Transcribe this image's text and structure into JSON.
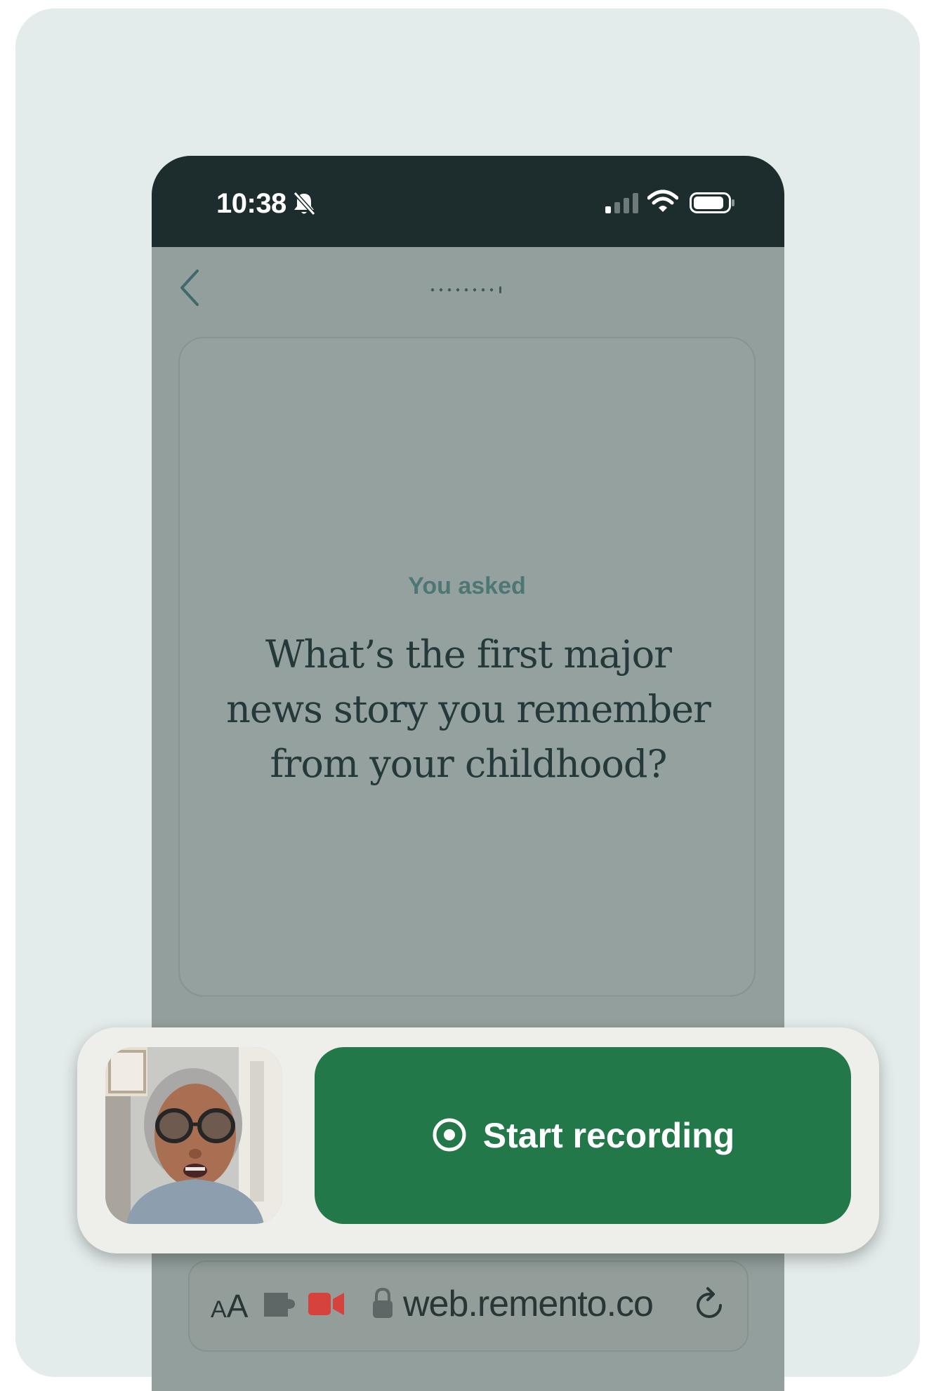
{
  "status_bar": {
    "time": "10:38"
  },
  "prompt": {
    "eyebrow": "You asked",
    "question": "What’s the first major news story you remember from your childhood?"
  },
  "recording": {
    "start_label": "Start recording"
  },
  "browser": {
    "text_size_label_small": "A",
    "text_size_label_large": "A",
    "url": "web.remento.co"
  },
  "colors": {
    "status_bar_bg": "#1d2c2c",
    "overlay_bg": "#939f9c",
    "accent_green": "#23784a",
    "eyebrow_teal": "#4c7775",
    "panel_bg": "#eeefea",
    "recording_indicator": "#d6433c"
  },
  "icons": [
    "bell-slash-icon",
    "cellular-signal-icon",
    "wifi-icon",
    "battery-icon",
    "back-chevron-icon",
    "record-icon",
    "puzzle-extension-icon",
    "camera-recording-icon",
    "lock-icon",
    "reload-icon"
  ]
}
